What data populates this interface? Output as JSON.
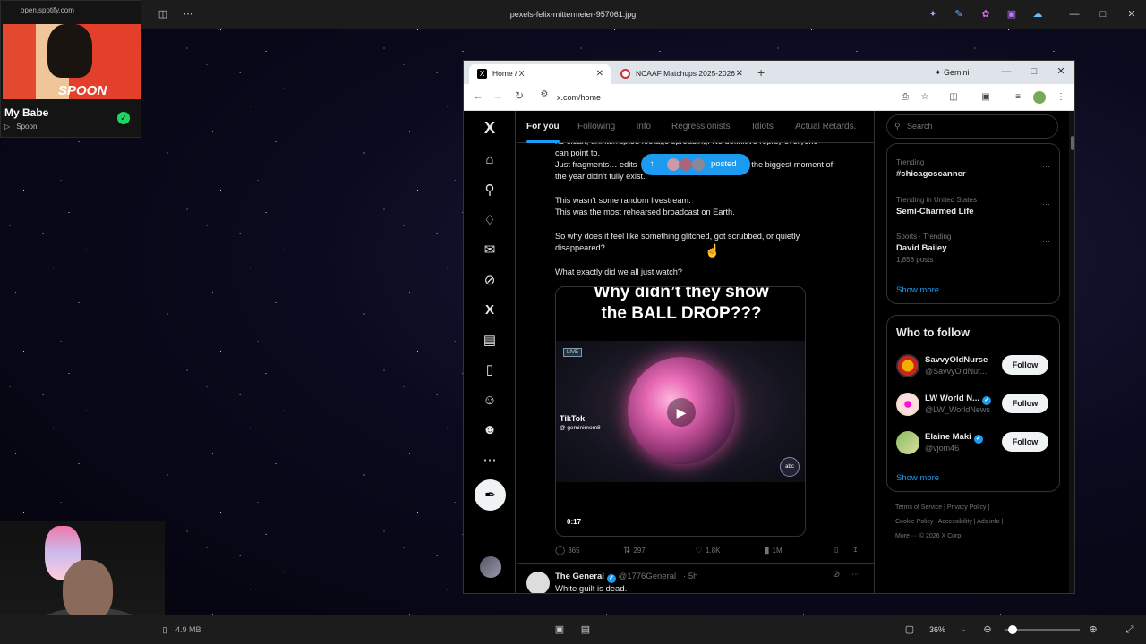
{
  "viewer": {
    "title": "pexels-felix-mittermeier-957061.jpg",
    "file_size": "4.9 MB",
    "zoom": "36%",
    "zoom_level_fraction": 0.05
  },
  "spotify": {
    "host": "open.spotify.com",
    "song": "My Babe",
    "artist": "Spoon",
    "album_word": "SPOON"
  },
  "browser": {
    "tabs": [
      {
        "label": "Home / X",
        "active": true
      },
      {
        "label": "NCAAF Matchups 2025-2026 -",
        "active": false
      }
    ],
    "gemini": "Gemini",
    "url": "x.com/home"
  },
  "x": {
    "feed_tabs": [
      "For you",
      "Following",
      "info",
      "Regressionists",
      "Idiots",
      "Actual Retards."
    ],
    "new_posts_pill": "posted",
    "post": {
      "line0": "no clean, uninterrupted footage spreading. No definitive replay everyone",
      "line1": "can point to.",
      "line2a": "Just fragments… edits",
      "line2b": "that the biggest moment of",
      "line3": "the year didn’t fully exist.",
      "line4": "This wasn’t some random livestream.",
      "line5": "This was the most rehearsed broadcast on Earth.",
      "line6": "So why does it feel like something glitched, got scrubbed, or quietly",
      "line7": "disappeared?",
      "line8": "What exactly did we all just watch?",
      "media_caption_1": "Why didn’t they show",
      "media_caption_2": "the BALL DROP???",
      "live": "LIVE",
      "tiktok": "TikTok",
      "tiktok_handle": "@ geminimom8",
      "abc": "abc",
      "duration": "0:17",
      "replies": "365",
      "reposts": "297",
      "likes": "1.8K",
      "views": "1M"
    },
    "post2": {
      "name": "The General",
      "handle": "@1776General_ · 5h",
      "text": "White guilt is dead."
    },
    "search_placeholder": "Search",
    "trends": [
      {
        "meta": "Trending",
        "name": "#chicagoscanner",
        "count": ""
      },
      {
        "meta": "Trending in United States",
        "name": "Semi-Charmed Life",
        "count": ""
      },
      {
        "meta": "Sports · Trending",
        "name": "David Bailey",
        "count": "1,858 posts"
      }
    ],
    "show_more": "Show more",
    "who_to_follow": "Who to follow",
    "follow_suggestions": [
      {
        "name": "SavvyOldNurse",
        "handle": "@SavvyOldNur...",
        "verified": false
      },
      {
        "name": "LW World N...",
        "handle": "@LW_WorldNews",
        "verified": true
      },
      {
        "name": "Elaine Maki",
        "handle": "@vjom46",
        "verified": true
      }
    ],
    "follow_label": "Follow",
    "footer": {
      "row1": "Terms of Service  |  Privacy Policy  |",
      "row2": "Cookie Policy  |  Accessibility  |  Ads info  |",
      "row3": "More ···  © 2026 X Corp."
    }
  }
}
